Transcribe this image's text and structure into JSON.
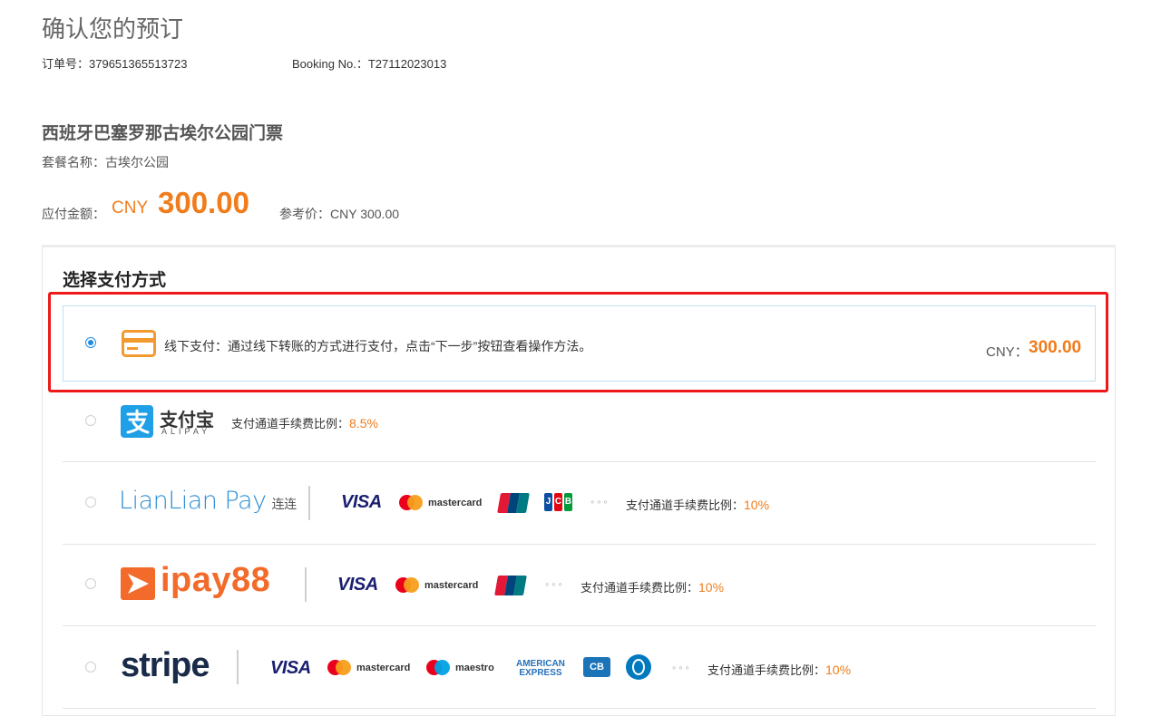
{
  "page": {
    "title": "确认您的预订",
    "order_no_label": "订单号：",
    "order_no": "379651365513723",
    "booking_label": "Booking No.：",
    "booking_no": "T27112023013",
    "product_title": "西班牙巴塞罗那古埃尔公园门票",
    "package_label": "套餐名称：",
    "package_name": "古埃尔公园",
    "amount_label": "应付金额：",
    "amount_currency": "CNY",
    "amount_value": "300.00",
    "ref_label": "参考价：",
    "ref_value": "CNY 300.00"
  },
  "payment": {
    "section_title": "选择支付方式",
    "accent_color": "#f07c1b",
    "highlight_color": "#ee1a1a",
    "methods": [
      {
        "id": "offline",
        "selected": true,
        "icon": "card-icon",
        "label": "线下支付：通过线下转账的方式进行支付，点击“下一步”按钮查看操作方法。",
        "currency_label": "CNY：",
        "amount": "300.00"
      },
      {
        "id": "alipay",
        "selected": false,
        "logo_cn": "支付宝",
        "logo_en": "ALIPAY",
        "fee_label": "支付通道手续费比例：",
        "fee_rate": "8.5%"
      },
      {
        "id": "lianlian",
        "selected": false,
        "logo": "LianLian Pay",
        "logo_cn": "连连",
        "cards": [
          "VISA",
          "mastercard",
          "UnionPay",
          "JCB"
        ],
        "more": "∘∘∘",
        "fee_label": "支付通道手续费比例：",
        "fee_rate": "10%"
      },
      {
        "id": "ipay88",
        "selected": false,
        "logo": "ipay88",
        "cards": [
          "VISA",
          "mastercard",
          "UnionPay"
        ],
        "more": "∘∘∘",
        "fee_label": "支付通道手续费比例：",
        "fee_rate": "10%"
      },
      {
        "id": "stripe",
        "selected": false,
        "logo": "stripe",
        "cards": [
          "VISA",
          "mastercard",
          "maestro",
          "AMERICAN",
          "EXPRESS",
          "CB",
          "Diners"
        ],
        "more": "∘∘∘",
        "fee_label": "支付通道手续费比例：",
        "fee_rate": "10%"
      }
    ]
  }
}
